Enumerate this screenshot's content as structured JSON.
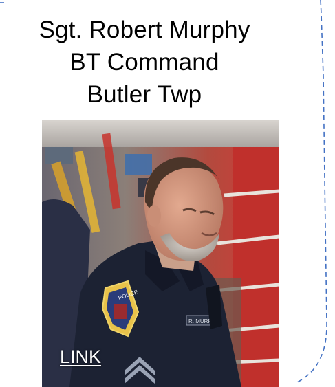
{
  "officer": {
    "name": "Sgt. Robert Murphy",
    "unit": "BT Command",
    "location": "Butler Twp"
  },
  "photo": {
    "link_label": "LINK",
    "patch_text": "POLICE",
    "nametag_text": "R. MURPHY"
  },
  "colors": {
    "frame_dash": "#4472c4",
    "uniform": "#1c2233",
    "background_red": "#c8282a"
  }
}
